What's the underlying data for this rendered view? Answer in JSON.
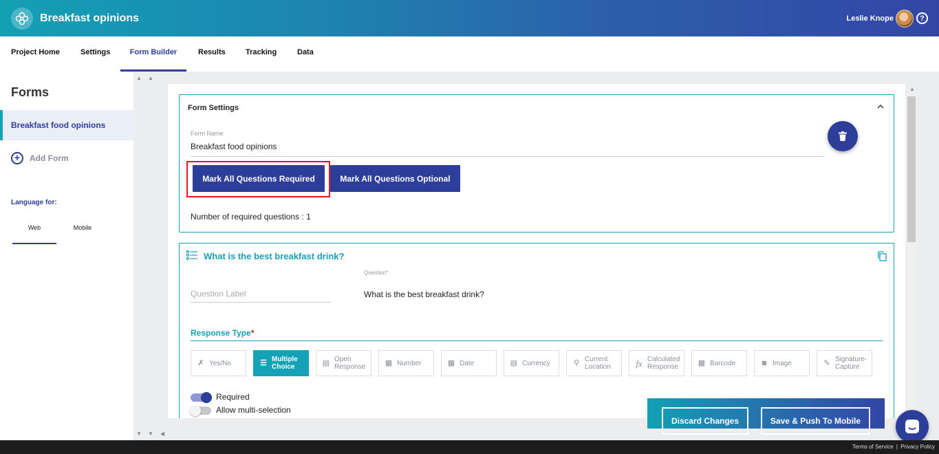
{
  "header": {
    "app_title": "Breakfast opinions",
    "user_name": "Leslie Knope",
    "help_symbol": "?",
    "icons": [
      "logo-icon",
      "avatar",
      "help-icon"
    ]
  },
  "nav": {
    "tabs": [
      {
        "label": "Project Home",
        "active": false
      },
      {
        "label": "Settings",
        "active": false
      },
      {
        "label": "Form Builder",
        "active": true
      },
      {
        "label": "Results",
        "active": false
      },
      {
        "label": "Tracking",
        "active": false
      },
      {
        "label": "Data",
        "active": false
      }
    ]
  },
  "sidebar": {
    "title": "Forms",
    "forms": [
      {
        "label": "Breakfast food opinions",
        "selected": true
      }
    ],
    "add_form_label": "Add Form",
    "language_label": "Language for:",
    "language_tabs": [
      {
        "label": "Web",
        "active": true
      },
      {
        "label": "Mobile",
        "active": false
      }
    ]
  },
  "form_settings": {
    "title": "Form Settings",
    "form_name_label": "Form Name",
    "form_name_value": "Breakfast food opinions",
    "mark_required_label": "Mark All Questions Required",
    "mark_optional_label": "Mark All Questions Optional",
    "required_count_text": "Number of required questions : 1"
  },
  "question": {
    "title": "What is the best breakfast drink?",
    "label_placeholder": "Question Label",
    "question_field_label": "Question*",
    "question_value": "What is the best breakfast drink?",
    "response_type_label": "Response Type",
    "response_type_required_mark": "*",
    "response_types": [
      {
        "label": "Yes/No",
        "icon": "yes-no-icon",
        "active": false
      },
      {
        "label": "Multiple Choice",
        "icon": "list-icon",
        "active": true
      },
      {
        "label": "Open Response",
        "icon": "text-box-icon",
        "active": false
      },
      {
        "label": "Number",
        "icon": "number-icon",
        "active": false
      },
      {
        "label": "Date",
        "icon": "calendar-icon",
        "active": false
      },
      {
        "label": "Currency",
        "icon": "currency-icon",
        "active": false
      },
      {
        "label": "Current Location",
        "icon": "location-icon",
        "active": false
      },
      {
        "label": "Calculated Response",
        "icon": "function-icon",
        "active": false
      },
      {
        "label": "Barcode",
        "icon": "barcode-icon",
        "active": false
      },
      {
        "label": "Image",
        "icon": "camera-icon",
        "active": false
      },
      {
        "label": "Signature-Capture",
        "icon": "pen-icon",
        "active": false
      }
    ],
    "toggles": [
      {
        "label": "Required",
        "on": true
      },
      {
        "label": "Allow multi-selection",
        "on": false
      }
    ]
  },
  "actions": {
    "discard_label": "Discard Changes",
    "save_label": "Save & Push To Mobile"
  },
  "footer": {
    "terms": "Terms of Service",
    "separator": "|",
    "privacy": "Privacy Policy"
  },
  "colors": {
    "brand_navy": "#2d3d9a",
    "brand_teal": "#15a2b7",
    "highlight_red": "#e0191f"
  }
}
